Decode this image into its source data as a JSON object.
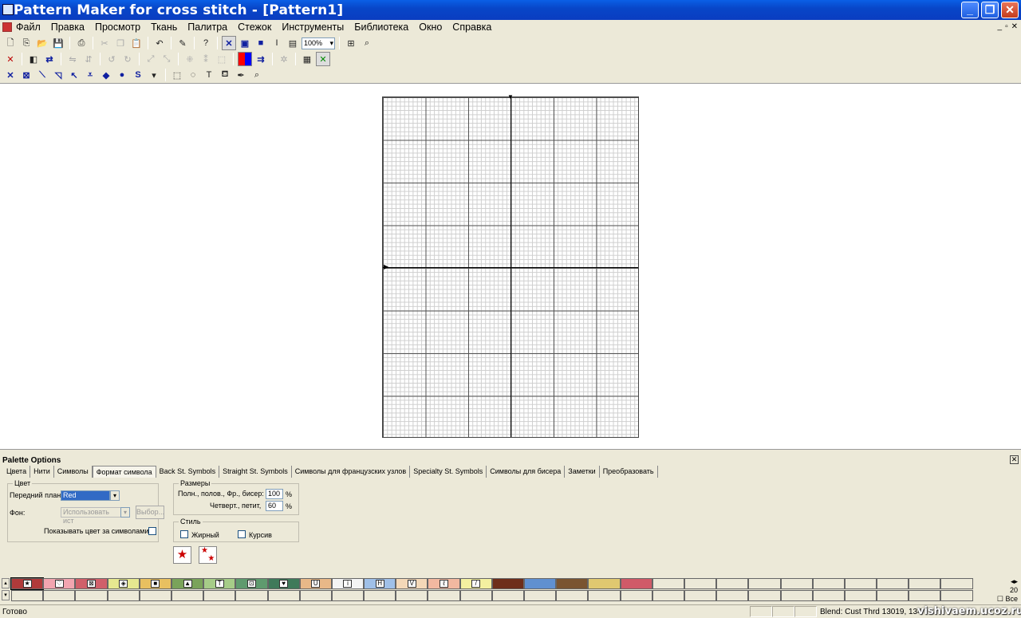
{
  "window": {
    "title": "Pattern Maker for cross stitch - [Pattern1]"
  },
  "menu": [
    "Файл",
    "Правка",
    "Просмотр",
    "Ткань",
    "Палитра",
    "Стежок",
    "Инструменты",
    "Библиотека",
    "Окно",
    "Справка"
  ],
  "toolbar": {
    "zoom": "100%"
  },
  "panel": {
    "title": "Palette Options",
    "tabs": [
      "Цвета",
      "Нити",
      "Символы",
      "Формат символа",
      "Back St. Symbols",
      "Straight St. Symbols",
      "Символы для французских узлов",
      "Specialty St. Symbols",
      "Символы для бисера",
      "Заметки",
      "Преобразовать"
    ],
    "active_tab": "Формат символа",
    "color_group": {
      "legend": "Цвет",
      "foreground_label": "Передний план:",
      "foreground_value": "Red",
      "background_label": "Фон:",
      "background_value": "Использовать ист",
      "choose_button": "Выбор...",
      "show_color_label": "Показывать цвет за символами"
    },
    "size_group": {
      "legend": "Размеры",
      "full_label": "Полн., полов., Фр., бисер:",
      "full_value": "100",
      "quarter_label": "Четверт., петит,",
      "quarter_value": "60",
      "unit": "%"
    },
    "style_group": {
      "legend": "Стиль",
      "bold_label": "Жирный",
      "italic_label": "Курсив"
    }
  },
  "palette": {
    "swatches": [
      {
        "color": "#b03a3a",
        "symbol": "★"
      },
      {
        "color": "#f2a5b0",
        "symbol": "♡"
      },
      {
        "color": "#d0606a",
        "symbol": "⊠"
      },
      {
        "color": "#e6e890",
        "symbol": "◈"
      },
      {
        "color": "#e8c060",
        "symbol": "■"
      },
      {
        "color": "#7aa35a",
        "symbol": "▲"
      },
      {
        "color": "#a6cc88",
        "symbol": "T"
      },
      {
        "color": "#5f9a6e",
        "symbol": "⊡"
      },
      {
        "color": "#3f7a5a",
        "symbol": "♥"
      },
      {
        "color": "#e8b888",
        "symbol": "U"
      },
      {
        "color": "#f4f4f4",
        "symbol": "i"
      },
      {
        "color": "#a0c0e8",
        "symbol": "H"
      },
      {
        "color": "#f4d8b8",
        "symbol": "V"
      },
      {
        "color": "#f2b8a0",
        "symbol": "ℓ"
      },
      {
        "color": "#f4f0a0",
        "symbol": "/"
      },
      {
        "color": "#6e2e1a",
        "symbol": ""
      },
      {
        "color": "#6090d0",
        "symbol": ""
      },
      {
        "color": "#7a5430",
        "symbol": ""
      },
      {
        "color": "#e0c870",
        "symbol": ""
      },
      {
        "color": "#d05a68",
        "symbol": ""
      }
    ],
    "empty_count": 10,
    "count": "20",
    "all_label": "Все"
  },
  "status": {
    "left": "Готово",
    "right": "Blend: Cust Thrd 13019, 134"
  },
  "watermark": "vishivaem.ucoz.ru"
}
